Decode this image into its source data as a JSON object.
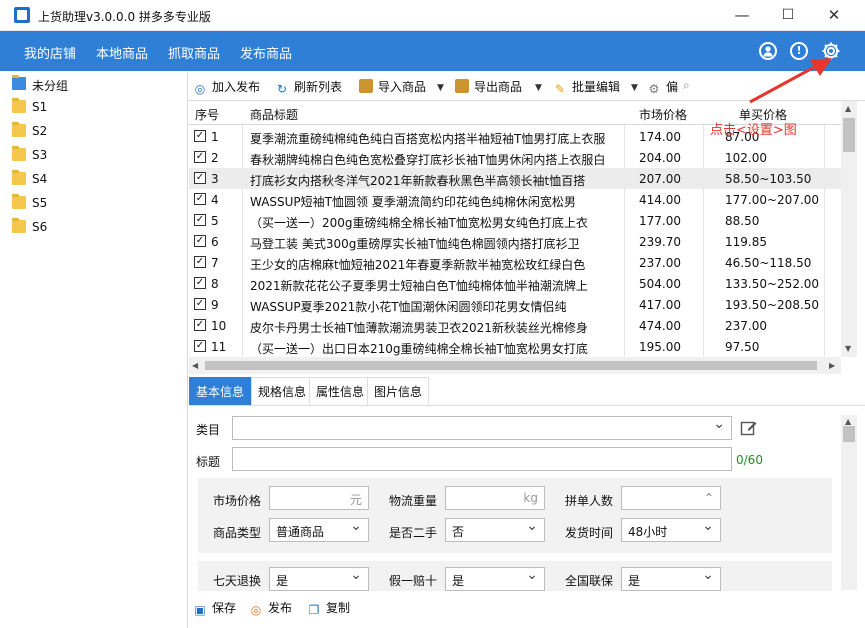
{
  "window": {
    "title": "上货助理v3.0.0.0 拼多多专业版",
    "minimize": "—",
    "maximize": "☐",
    "close": "✕"
  },
  "menu": [
    "我的店铺",
    "本地商品",
    "抓取商品",
    "发布商品"
  ],
  "header_icons": [
    "user-icon",
    "info-icon",
    "gear-icon"
  ],
  "sidebar": {
    "items": [
      "未分组",
      "S1",
      "S2",
      "S3",
      "S4",
      "S5",
      "S6"
    ]
  },
  "toolbar": {
    "add_publish": "加入发布",
    "refresh": "刷新列表",
    "import": "导入商品",
    "export": "导出商品",
    "batch_edit": "批量编辑",
    "settings_partial": "偏"
  },
  "table": {
    "columns": [
      "序号",
      "商品标题",
      "市场价格",
      "单买价格"
    ],
    "rows": [
      {
        "no": "1",
        "title": "夏季潮流重磅纯棉纯色纯白百搭宽松内搭半袖短袖T恤男打底上衣服",
        "market": "174.00",
        "single": "87.00"
      },
      {
        "no": "2",
        "title": "春秋潮牌纯棉白色纯色宽松叠穿打底衫长袖T恤男休闲内搭上衣服白",
        "market": "204.00",
        "single": "102.00"
      },
      {
        "no": "3",
        "title": "打底衫女内搭秋冬洋气2021年新款春秋黑色半高领长袖t恤百搭",
        "market": "207.00",
        "single": "58.50~103.50"
      },
      {
        "no": "4",
        "title": "WASSUP短袖T恤圆领 夏季潮流简约印花纯色纯棉休闲宽松男",
        "market": "414.00",
        "single": "177.00~207.00"
      },
      {
        "no": "5",
        "title": "（买一送一）200g重磅纯棉全棉长袖T恤宽松男女纯色打底上衣",
        "market": "177.00",
        "single": "88.50"
      },
      {
        "no": "6",
        "title": "马登工装 美式300g重磅厚实长袖T恤纯色棉圆领内搭打底衫卫",
        "market": "239.70",
        "single": "119.85"
      },
      {
        "no": "7",
        "title": "王少女的店棉麻t恤短袖2021年春夏季新款半袖宽松玫红绿白色",
        "market": "237.00",
        "single": "46.50~118.50"
      },
      {
        "no": "8",
        "title": "2021新款花花公子夏季男士短袖白色T恤纯棉体恤半袖潮流牌上",
        "market": "504.00",
        "single": "133.50~252.00"
      },
      {
        "no": "9",
        "title": "WASSUP夏季2021款小花T恤国潮休闲圆领印花男女情侣纯",
        "market": "417.00",
        "single": "193.50~208.50"
      },
      {
        "no": "10",
        "title": "皮尔卡丹男士长袖T恤薄款潮流男装卫衣2021新秋装丝光棉修身",
        "market": "474.00",
        "single": "237.00"
      },
      {
        "no": "11",
        "title": "（买一送一）出口日本210g重磅纯棉全棉长袖T恤宽松男女打底",
        "market": "195.00",
        "single": "97.50"
      }
    ]
  },
  "tabs": [
    "基本信息",
    "规格信息",
    "属性信息",
    "图片信息"
  ],
  "form": {
    "category_label": "类目",
    "title_label": "标题",
    "title_count": "0/60",
    "market_price_label": "市场价格",
    "market_price_unit": "元",
    "weight_label": "物流重量",
    "weight_unit": "kg",
    "group_count_label": "拼单人数",
    "product_type_label": "商品类型",
    "product_type_value": "普通商品",
    "second_hand_label": "是否二手",
    "second_hand_value": "否",
    "ship_time_label": "发货时间",
    "ship_time_value": "48小时",
    "return_label": "七天退换",
    "return_value": "是",
    "fake_label": "假一赔十",
    "fake_value": "是",
    "warranty_label": "全国联保",
    "warranty_value": "是"
  },
  "bottom": {
    "save": "保存",
    "publish": "发布",
    "copy": "复制"
  },
  "annotation": {
    "text": "点击<设置>图",
    "color": "#e8352e"
  }
}
